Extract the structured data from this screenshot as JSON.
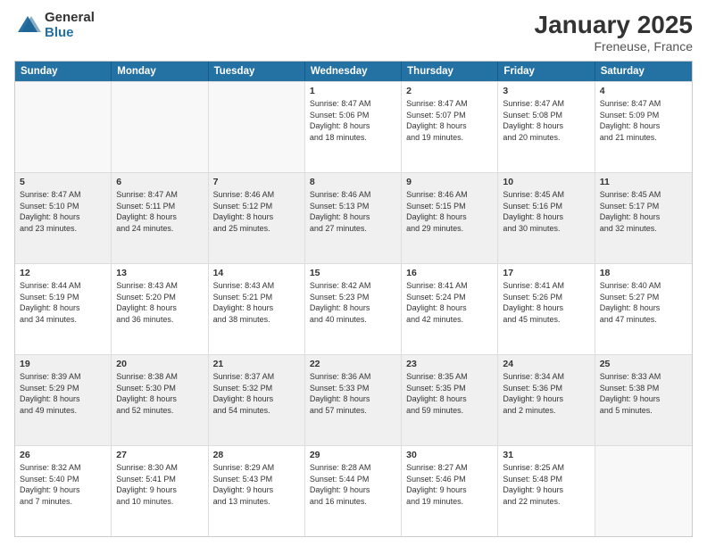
{
  "logo": {
    "general": "General",
    "blue": "Blue"
  },
  "title": "January 2025",
  "subtitle": "Freneuse, France",
  "days": [
    "Sunday",
    "Monday",
    "Tuesday",
    "Wednesday",
    "Thursday",
    "Friday",
    "Saturday"
  ],
  "weeks": [
    [
      {
        "day": "",
        "info": ""
      },
      {
        "day": "",
        "info": ""
      },
      {
        "day": "",
        "info": ""
      },
      {
        "day": "1",
        "info": "Sunrise: 8:47 AM\nSunset: 5:06 PM\nDaylight: 8 hours\nand 18 minutes."
      },
      {
        "day": "2",
        "info": "Sunrise: 8:47 AM\nSunset: 5:07 PM\nDaylight: 8 hours\nand 19 minutes."
      },
      {
        "day": "3",
        "info": "Sunrise: 8:47 AM\nSunset: 5:08 PM\nDaylight: 8 hours\nand 20 minutes."
      },
      {
        "day": "4",
        "info": "Sunrise: 8:47 AM\nSunset: 5:09 PM\nDaylight: 8 hours\nand 21 minutes."
      }
    ],
    [
      {
        "day": "5",
        "info": "Sunrise: 8:47 AM\nSunset: 5:10 PM\nDaylight: 8 hours\nand 23 minutes."
      },
      {
        "day": "6",
        "info": "Sunrise: 8:47 AM\nSunset: 5:11 PM\nDaylight: 8 hours\nand 24 minutes."
      },
      {
        "day": "7",
        "info": "Sunrise: 8:46 AM\nSunset: 5:12 PM\nDaylight: 8 hours\nand 25 minutes."
      },
      {
        "day": "8",
        "info": "Sunrise: 8:46 AM\nSunset: 5:13 PM\nDaylight: 8 hours\nand 27 minutes."
      },
      {
        "day": "9",
        "info": "Sunrise: 8:46 AM\nSunset: 5:15 PM\nDaylight: 8 hours\nand 29 minutes."
      },
      {
        "day": "10",
        "info": "Sunrise: 8:45 AM\nSunset: 5:16 PM\nDaylight: 8 hours\nand 30 minutes."
      },
      {
        "day": "11",
        "info": "Sunrise: 8:45 AM\nSunset: 5:17 PM\nDaylight: 8 hours\nand 32 minutes."
      }
    ],
    [
      {
        "day": "12",
        "info": "Sunrise: 8:44 AM\nSunset: 5:19 PM\nDaylight: 8 hours\nand 34 minutes."
      },
      {
        "day": "13",
        "info": "Sunrise: 8:43 AM\nSunset: 5:20 PM\nDaylight: 8 hours\nand 36 minutes."
      },
      {
        "day": "14",
        "info": "Sunrise: 8:43 AM\nSunset: 5:21 PM\nDaylight: 8 hours\nand 38 minutes."
      },
      {
        "day": "15",
        "info": "Sunrise: 8:42 AM\nSunset: 5:23 PM\nDaylight: 8 hours\nand 40 minutes."
      },
      {
        "day": "16",
        "info": "Sunrise: 8:41 AM\nSunset: 5:24 PM\nDaylight: 8 hours\nand 42 minutes."
      },
      {
        "day": "17",
        "info": "Sunrise: 8:41 AM\nSunset: 5:26 PM\nDaylight: 8 hours\nand 45 minutes."
      },
      {
        "day": "18",
        "info": "Sunrise: 8:40 AM\nSunset: 5:27 PM\nDaylight: 8 hours\nand 47 minutes."
      }
    ],
    [
      {
        "day": "19",
        "info": "Sunrise: 8:39 AM\nSunset: 5:29 PM\nDaylight: 8 hours\nand 49 minutes."
      },
      {
        "day": "20",
        "info": "Sunrise: 8:38 AM\nSunset: 5:30 PM\nDaylight: 8 hours\nand 52 minutes."
      },
      {
        "day": "21",
        "info": "Sunrise: 8:37 AM\nSunset: 5:32 PM\nDaylight: 8 hours\nand 54 minutes."
      },
      {
        "day": "22",
        "info": "Sunrise: 8:36 AM\nSunset: 5:33 PM\nDaylight: 8 hours\nand 57 minutes."
      },
      {
        "day": "23",
        "info": "Sunrise: 8:35 AM\nSunset: 5:35 PM\nDaylight: 8 hours\nand 59 minutes."
      },
      {
        "day": "24",
        "info": "Sunrise: 8:34 AM\nSunset: 5:36 PM\nDaylight: 9 hours\nand 2 minutes."
      },
      {
        "day": "25",
        "info": "Sunrise: 8:33 AM\nSunset: 5:38 PM\nDaylight: 9 hours\nand 5 minutes."
      }
    ],
    [
      {
        "day": "26",
        "info": "Sunrise: 8:32 AM\nSunset: 5:40 PM\nDaylight: 9 hours\nand 7 minutes."
      },
      {
        "day": "27",
        "info": "Sunrise: 8:30 AM\nSunset: 5:41 PM\nDaylight: 9 hours\nand 10 minutes."
      },
      {
        "day": "28",
        "info": "Sunrise: 8:29 AM\nSunset: 5:43 PM\nDaylight: 9 hours\nand 13 minutes."
      },
      {
        "day": "29",
        "info": "Sunrise: 8:28 AM\nSunset: 5:44 PM\nDaylight: 9 hours\nand 16 minutes."
      },
      {
        "day": "30",
        "info": "Sunrise: 8:27 AM\nSunset: 5:46 PM\nDaylight: 9 hours\nand 19 minutes."
      },
      {
        "day": "31",
        "info": "Sunrise: 8:25 AM\nSunset: 5:48 PM\nDaylight: 9 hours\nand 22 minutes."
      },
      {
        "day": "",
        "info": ""
      }
    ]
  ]
}
